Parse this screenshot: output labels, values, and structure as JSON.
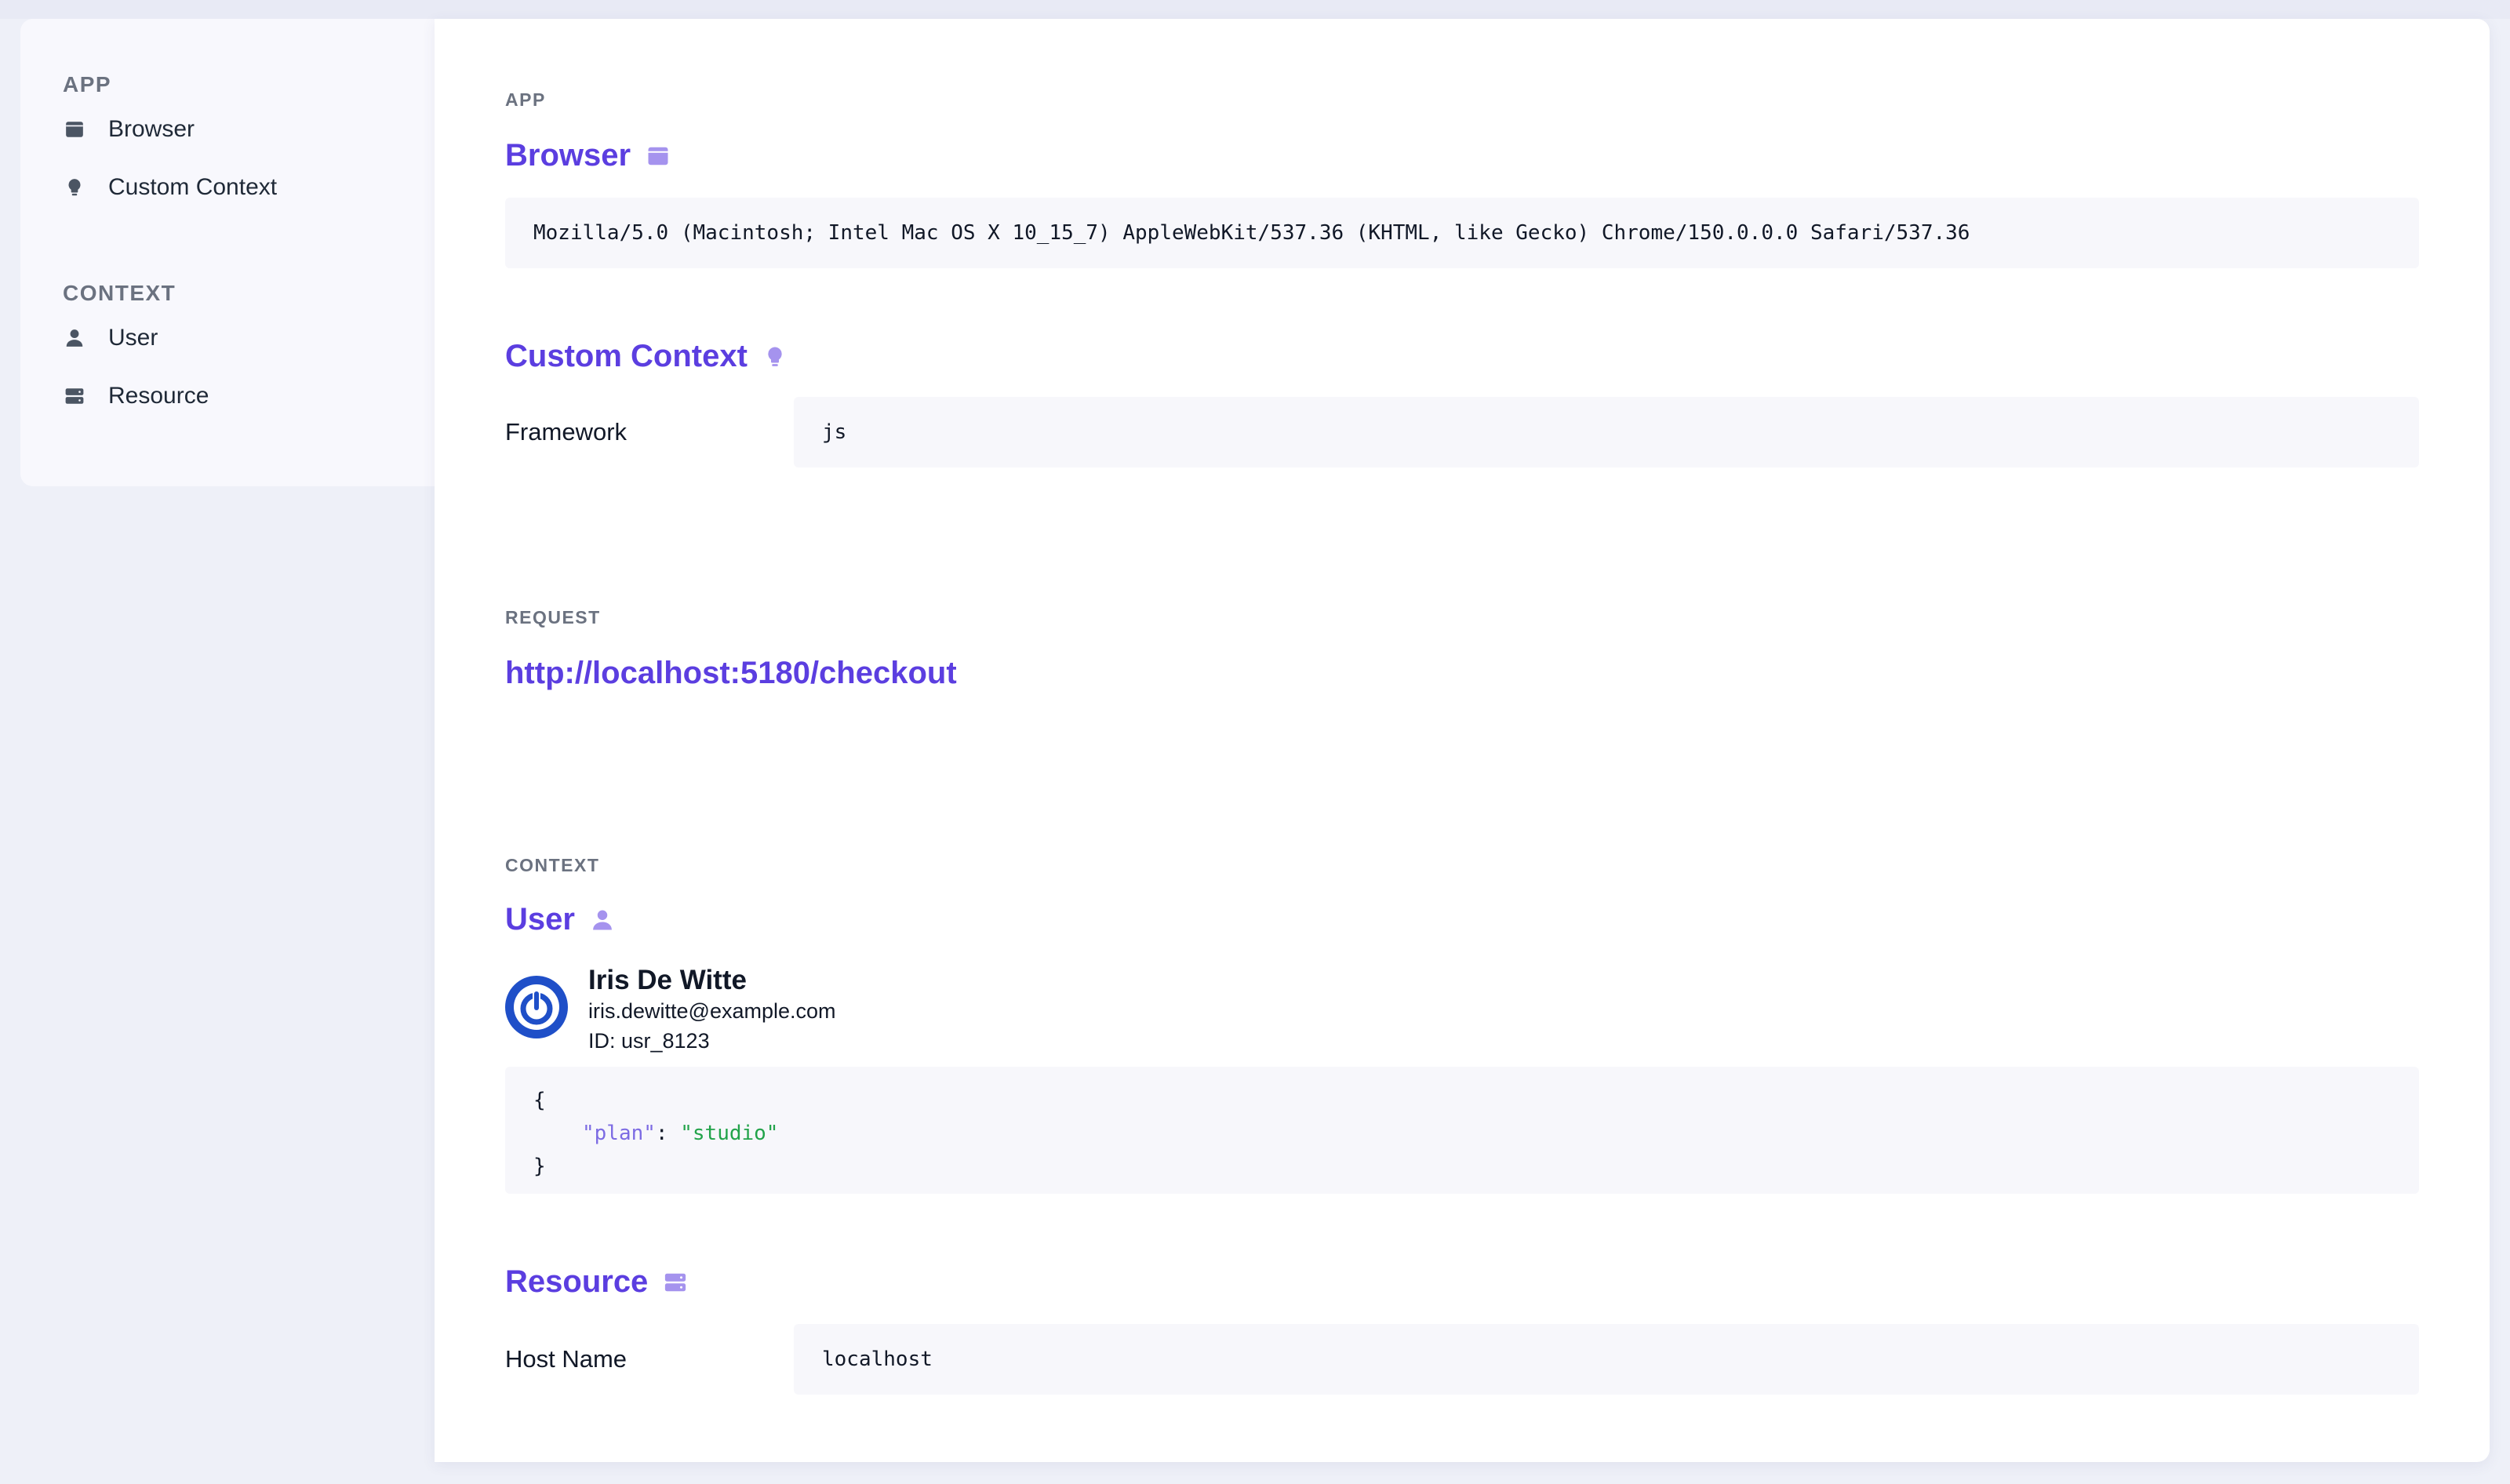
{
  "sidebar": {
    "groups": [
      {
        "title": "APP",
        "items": [
          {
            "label": "Browser",
            "icon": "browser-icon"
          },
          {
            "label": "Custom Context",
            "icon": "lightbulb-icon"
          }
        ]
      },
      {
        "title": "CONTEXT",
        "items": [
          {
            "label": "User",
            "icon": "user-icon"
          },
          {
            "label": "Resource",
            "icon": "server-icon"
          }
        ]
      }
    ]
  },
  "main": {
    "app_section": {
      "label": "APP",
      "browser": {
        "title": "Browser",
        "icon": "browser-icon",
        "value": "Mozilla/5.0 (Macintosh; Intel Mac OS X 10_15_7) AppleWebKit/537.36 (KHTML, like Gecko) Chrome/150.0.0.0 Safari/537.36"
      },
      "custom_context": {
        "title": "Custom Context",
        "icon": "lightbulb-icon",
        "rows": [
          {
            "key": "Framework",
            "value": "js"
          }
        ]
      }
    },
    "request_section": {
      "label": "REQUEST",
      "url": "http://localhost:5180/checkout"
    },
    "context_section": {
      "label": "CONTEXT",
      "user": {
        "title": "User",
        "icon": "user-icon",
        "name": "Iris De Witte",
        "email": "iris.dewitte@example.com",
        "id_line": "ID: usr_8123",
        "json": {
          "open": "{",
          "key": "\"plan\"",
          "colon": ": ",
          "value": "\"studio\"",
          "close": "}"
        }
      },
      "resource": {
        "title": "Resource",
        "icon": "server-icon",
        "rows": [
          {
            "key": "Host Name",
            "value": "localhost"
          }
        ]
      }
    }
  },
  "colors": {
    "accent": "#5b3ee0",
    "accent_light": "#a593ee",
    "json_key": "#7c6be3",
    "json_string": "#22a34a",
    "avatar_blue": "#1f4fc8"
  }
}
